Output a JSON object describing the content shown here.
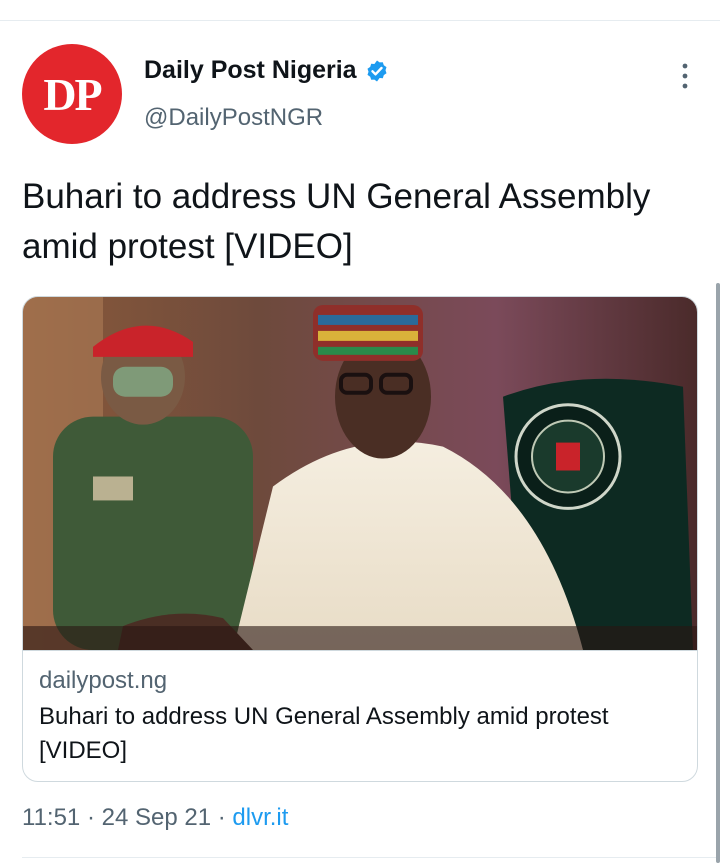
{
  "account": {
    "avatar_text": "DP",
    "display_name": "Daily Post Nigeria",
    "handle": "@DailyPostNGR",
    "verified": true
  },
  "tweet": {
    "text": "Buhari to address UN General Assembly amid protest [VIDEO]"
  },
  "card": {
    "domain": "dailypost.ng",
    "title": "Buhari to address UN General Assembly amid protest [VIDEO]",
    "image_icon": "news-photo"
  },
  "meta": {
    "time": "11:51",
    "separator": "·",
    "date": "24 Sep 21",
    "source": "dlvr.it"
  },
  "colors": {
    "brand_red": "#e3262c",
    "link_blue": "#1d9bf0",
    "muted_text": "#536471",
    "border": "#cfd9de"
  }
}
